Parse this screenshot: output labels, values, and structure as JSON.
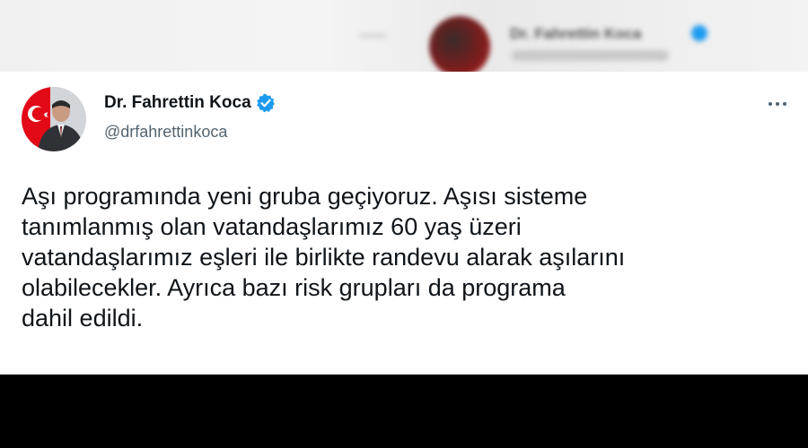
{
  "background_header": {
    "name": "Dr. Fahrettin Koca",
    "handle": "@drfahrettinkoca"
  },
  "tweet": {
    "display_name": "Dr. Fahrettin Koca",
    "handle": "@drfahrettinkoca",
    "verified": true,
    "text": "Aşı programında yeni gruba geçiyoruz. Aşısı sisteme\ntanımlanmış olan vatandaşlarımız 60 yaş üzeri\nvatandaşlarımız eşleri ile birlikte randevu alarak aşılarını\nolabilecekler. Ayrıca bazı risk grupları da programa\ndahil edildi."
  },
  "icons": {
    "verified": "verified-badge-icon",
    "more": "more-options-icon"
  },
  "colors": {
    "verified_blue": "#1d9bf0",
    "text": "#0f1419",
    "secondary": "#536471",
    "flag_red": "#e30a17"
  }
}
